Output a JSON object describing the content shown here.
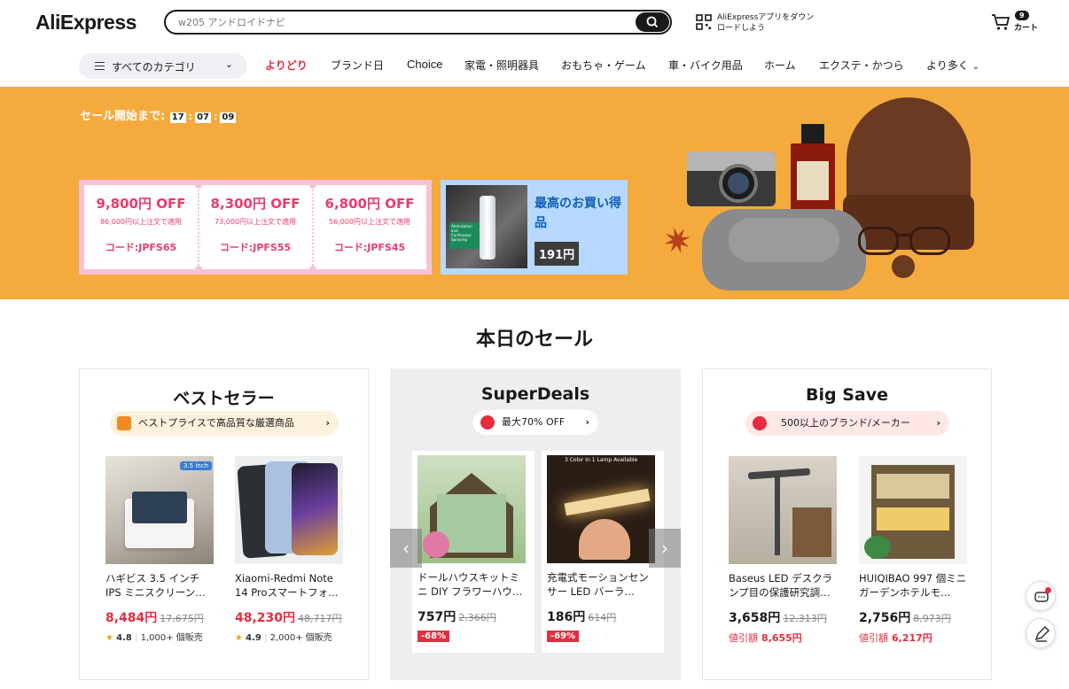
{
  "header": {
    "logo": "AliExpress",
    "search_placeholder": "w205 アンドロイドナビ",
    "app_download_line1": "AliExpressアプリをダウン",
    "app_download_line2": "ロードしよう",
    "cart_count": "9",
    "cart_label": "カート"
  },
  "nav": {
    "categories_label": "すべてのカテゴリ",
    "items": [
      "よりどり",
      "ブランド日",
      "Choice",
      "家電・照明器具",
      "おもちゃ・ゲーム",
      "車・バイク用品",
      "ホーム",
      "エクステ・かつら",
      "より多く"
    ]
  },
  "banner": {
    "countdown_label": "セール開始まで:",
    "countdown": [
      "17",
      "07",
      "09"
    ],
    "coupons": [
      {
        "amount": "9,800円 OFF",
        "condition": "86,000円以上注文で適用",
        "code": "コード:JPFS65"
      },
      {
        "amount": "8,300円 OFF",
        "condition": "73,000円以上注文で適用",
        "code": "コード:JPFS55"
      },
      {
        "amount": "6,800円 OFF",
        "condition": "56,000円以上注文で適用",
        "code": "コード:JPFS45"
      }
    ],
    "deal_title": "最高のお買い得品",
    "deal_price": "191円",
    "deal_image_text": "Atomization and Continuous Spraying"
  },
  "section": {
    "title": "本日のセール",
    "columns": [
      {
        "title": "ベストセラー",
        "pill": "ベストプライスで高品質な厳選商品",
        "products": [
          {
            "name": "ハギビス 3.5 インチ IPS ミニスクリーン…",
            "price": "8,484円",
            "orig": "17,675円",
            "rating": "4.8",
            "sold": "1,000+ 個販売",
            "tag": "3.5 inch"
          },
          {
            "name": "Xiaomi-Redmi Note 14 Proスマートフォ…",
            "price": "48,230円",
            "orig": "48,717円",
            "rating": "4.9",
            "sold": "2,000+ 個販売"
          }
        ]
      },
      {
        "title": "SuperDeals",
        "pill": "最大70% OFF",
        "products": [
          {
            "name": "ドールハウスキットミニ DIY フラワーハウ…",
            "price": "757円",
            "orig": "2,366円",
            "discount": "-68%"
          },
          {
            "name": "充電式モーションセンサー LED バーラ…",
            "price": "186円",
            "orig": "614円",
            "discount": "-69%",
            "tag": "3 Color In 1 Lamp Available"
          }
        ]
      },
      {
        "title": "Big Save",
        "pill": "500以上のブランド/メーカー",
        "products": [
          {
            "name": "Baseus LED デスクランプ目の保護研究調…",
            "price": "3,658円",
            "orig": "12,313円",
            "save_label": "値引額",
            "save": "8,655円"
          },
          {
            "name": "HUIQIBAO 997 個ミニガーデンホテルモ…",
            "price": "2,756円",
            "orig": "8,973円",
            "save_label": "値引額",
            "save": "6,217円"
          }
        ]
      }
    ]
  }
}
